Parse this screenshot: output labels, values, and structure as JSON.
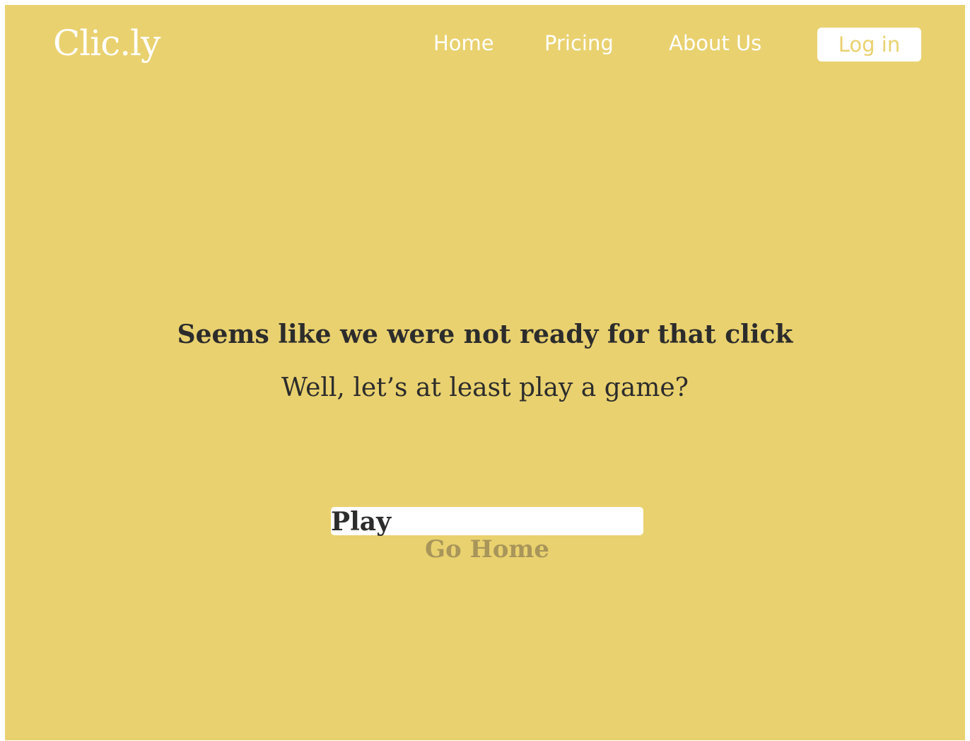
{
  "brand": {
    "logo_text": "Clic.ly"
  },
  "nav": {
    "items": [
      {
        "label": "Home"
      },
      {
        "label": "Pricing"
      },
      {
        "label": "About Us"
      }
    ],
    "login_label": "Log in"
  },
  "main": {
    "headline": "Seems like we were not ready for that click",
    "subline": "Well, let’s at least play a game?",
    "play_label": "Play",
    "go_home_label": "Go Home"
  },
  "colors": {
    "background": "#e9d16f",
    "text_dark": "#2c2c2c",
    "white": "#ffffff",
    "muted_link": "#a8955a"
  }
}
